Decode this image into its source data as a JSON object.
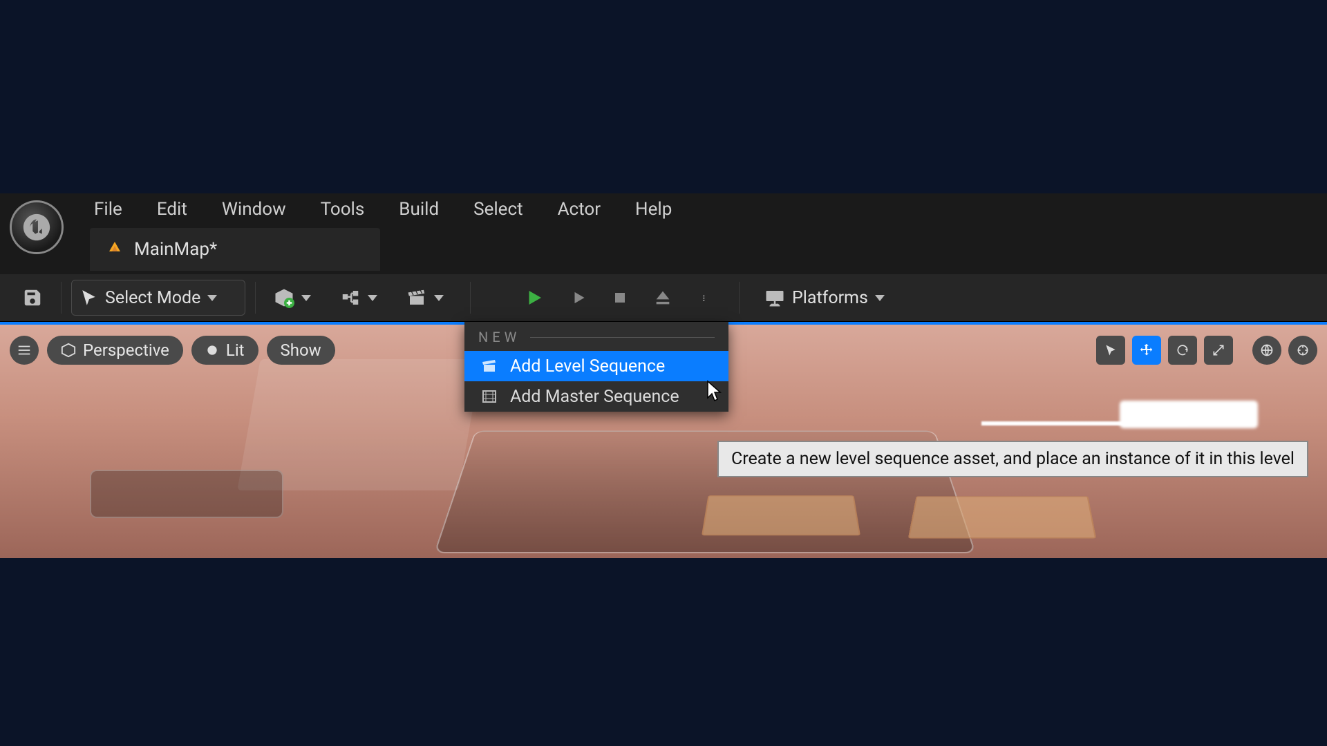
{
  "menubar": {
    "items": [
      "File",
      "Edit",
      "Window",
      "Tools",
      "Build",
      "Select",
      "Actor",
      "Help"
    ]
  },
  "tab": {
    "label": "MainMap*"
  },
  "toolbar": {
    "select_mode": "Select Mode",
    "platforms": "Platforms"
  },
  "viewport": {
    "perspective": "Perspective",
    "lit": "Lit",
    "show": "Show"
  },
  "dropdown": {
    "header": "NEW",
    "items": [
      {
        "label": "Add Level Sequence",
        "hover": true
      },
      {
        "label": "Add Master Sequence",
        "hover": false
      }
    ]
  },
  "tooltip": "Create a new level sequence asset, and place an instance of it in this level"
}
